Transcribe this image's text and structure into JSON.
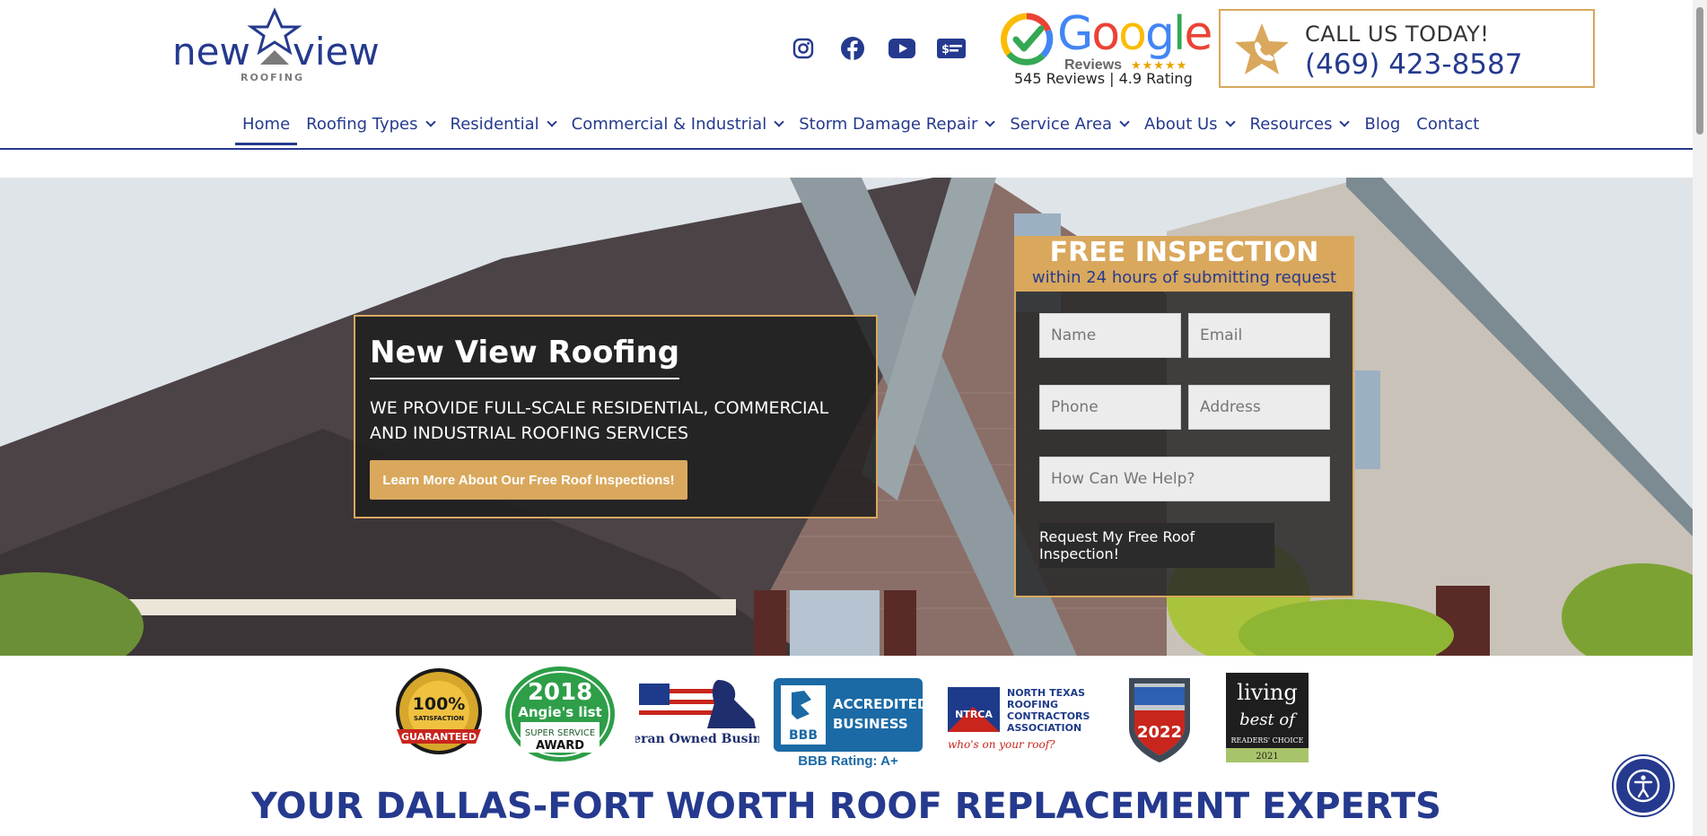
{
  "brand": {
    "logo_word": "newview",
    "logo_sub": "ROOFING",
    "accent": "#d9a85d",
    "navy": "#253a8e"
  },
  "social": [
    {
      "icon": "instagram-icon"
    },
    {
      "icon": "facebook-icon"
    },
    {
      "icon": "youtube-icon"
    },
    {
      "icon": "financing-icon"
    }
  ],
  "google": {
    "word": "Google",
    "sub": "Reviews",
    "stars": "★★★★★",
    "rating_text": "545 Reviews | 4.9 Rating"
  },
  "call": {
    "title": "CALL US TODAY!",
    "phone": "(469) 423-8587"
  },
  "nav": {
    "items": [
      {
        "label": "Home",
        "dropdown": false,
        "active": true
      },
      {
        "label": "Roofing Types",
        "dropdown": true
      },
      {
        "label": "Residential",
        "dropdown": true
      },
      {
        "label": "Commercial & Industrial",
        "dropdown": true
      },
      {
        "label": "Storm Damage Repair",
        "dropdown": true
      },
      {
        "label": "Service Area",
        "dropdown": true
      },
      {
        "label": "About Us",
        "dropdown": true
      },
      {
        "label": "Resources",
        "dropdown": true
      },
      {
        "label": "Blog",
        "dropdown": false
      },
      {
        "label": "Contact",
        "dropdown": false
      }
    ]
  },
  "intro": {
    "title": "New View Roofing",
    "text": "WE PROVIDE FULL-SCALE RESIDENTIAL, COMMERCIAL AND INDUSTRIAL ROOFING SERVICES",
    "button": "Learn More About Our Free Roof Inspections!"
  },
  "form": {
    "title": "FREE INSPECTION",
    "subtitle": "within 24 hours of submitting request",
    "name_placeholder": "Name",
    "email_placeholder": "Email",
    "phone_placeholder": "Phone",
    "address_placeholder": "Address",
    "help_placeholder": "How Can We Help?",
    "submit": "Request My Free Roof Inspection!"
  },
  "badges": {
    "satisfaction": {
      "top": "100%",
      "mid": "SATISFACTION",
      "ribbon": "GUARANTEED"
    },
    "angies": {
      "year": "2018",
      "brand": "Angie's list",
      "line1": "SUPER SERVICE",
      "line2": "AWARD"
    },
    "veteran": "Veteran Owned Business",
    "bbb": {
      "line1": "ACCREDITED",
      "line2": "BUSINESS",
      "rating": "BBB Rating: A+"
    },
    "ntrca": {
      "abbr": "NTRCA",
      "line1": "NORTH TEXAS",
      "line2": "ROOFING",
      "line3": "CONTRACTORS",
      "line4": "ASSOCIATION",
      "tagline": "who's on your roof?"
    },
    "award_year": "2022",
    "living": {
      "line1": "living",
      "line2": "best of",
      "line3": "READERS' CHOICE",
      "year": "2021"
    }
  },
  "headline": "YOUR DALLAS-FORT WORTH ROOF REPLACEMENT EXPERTS"
}
